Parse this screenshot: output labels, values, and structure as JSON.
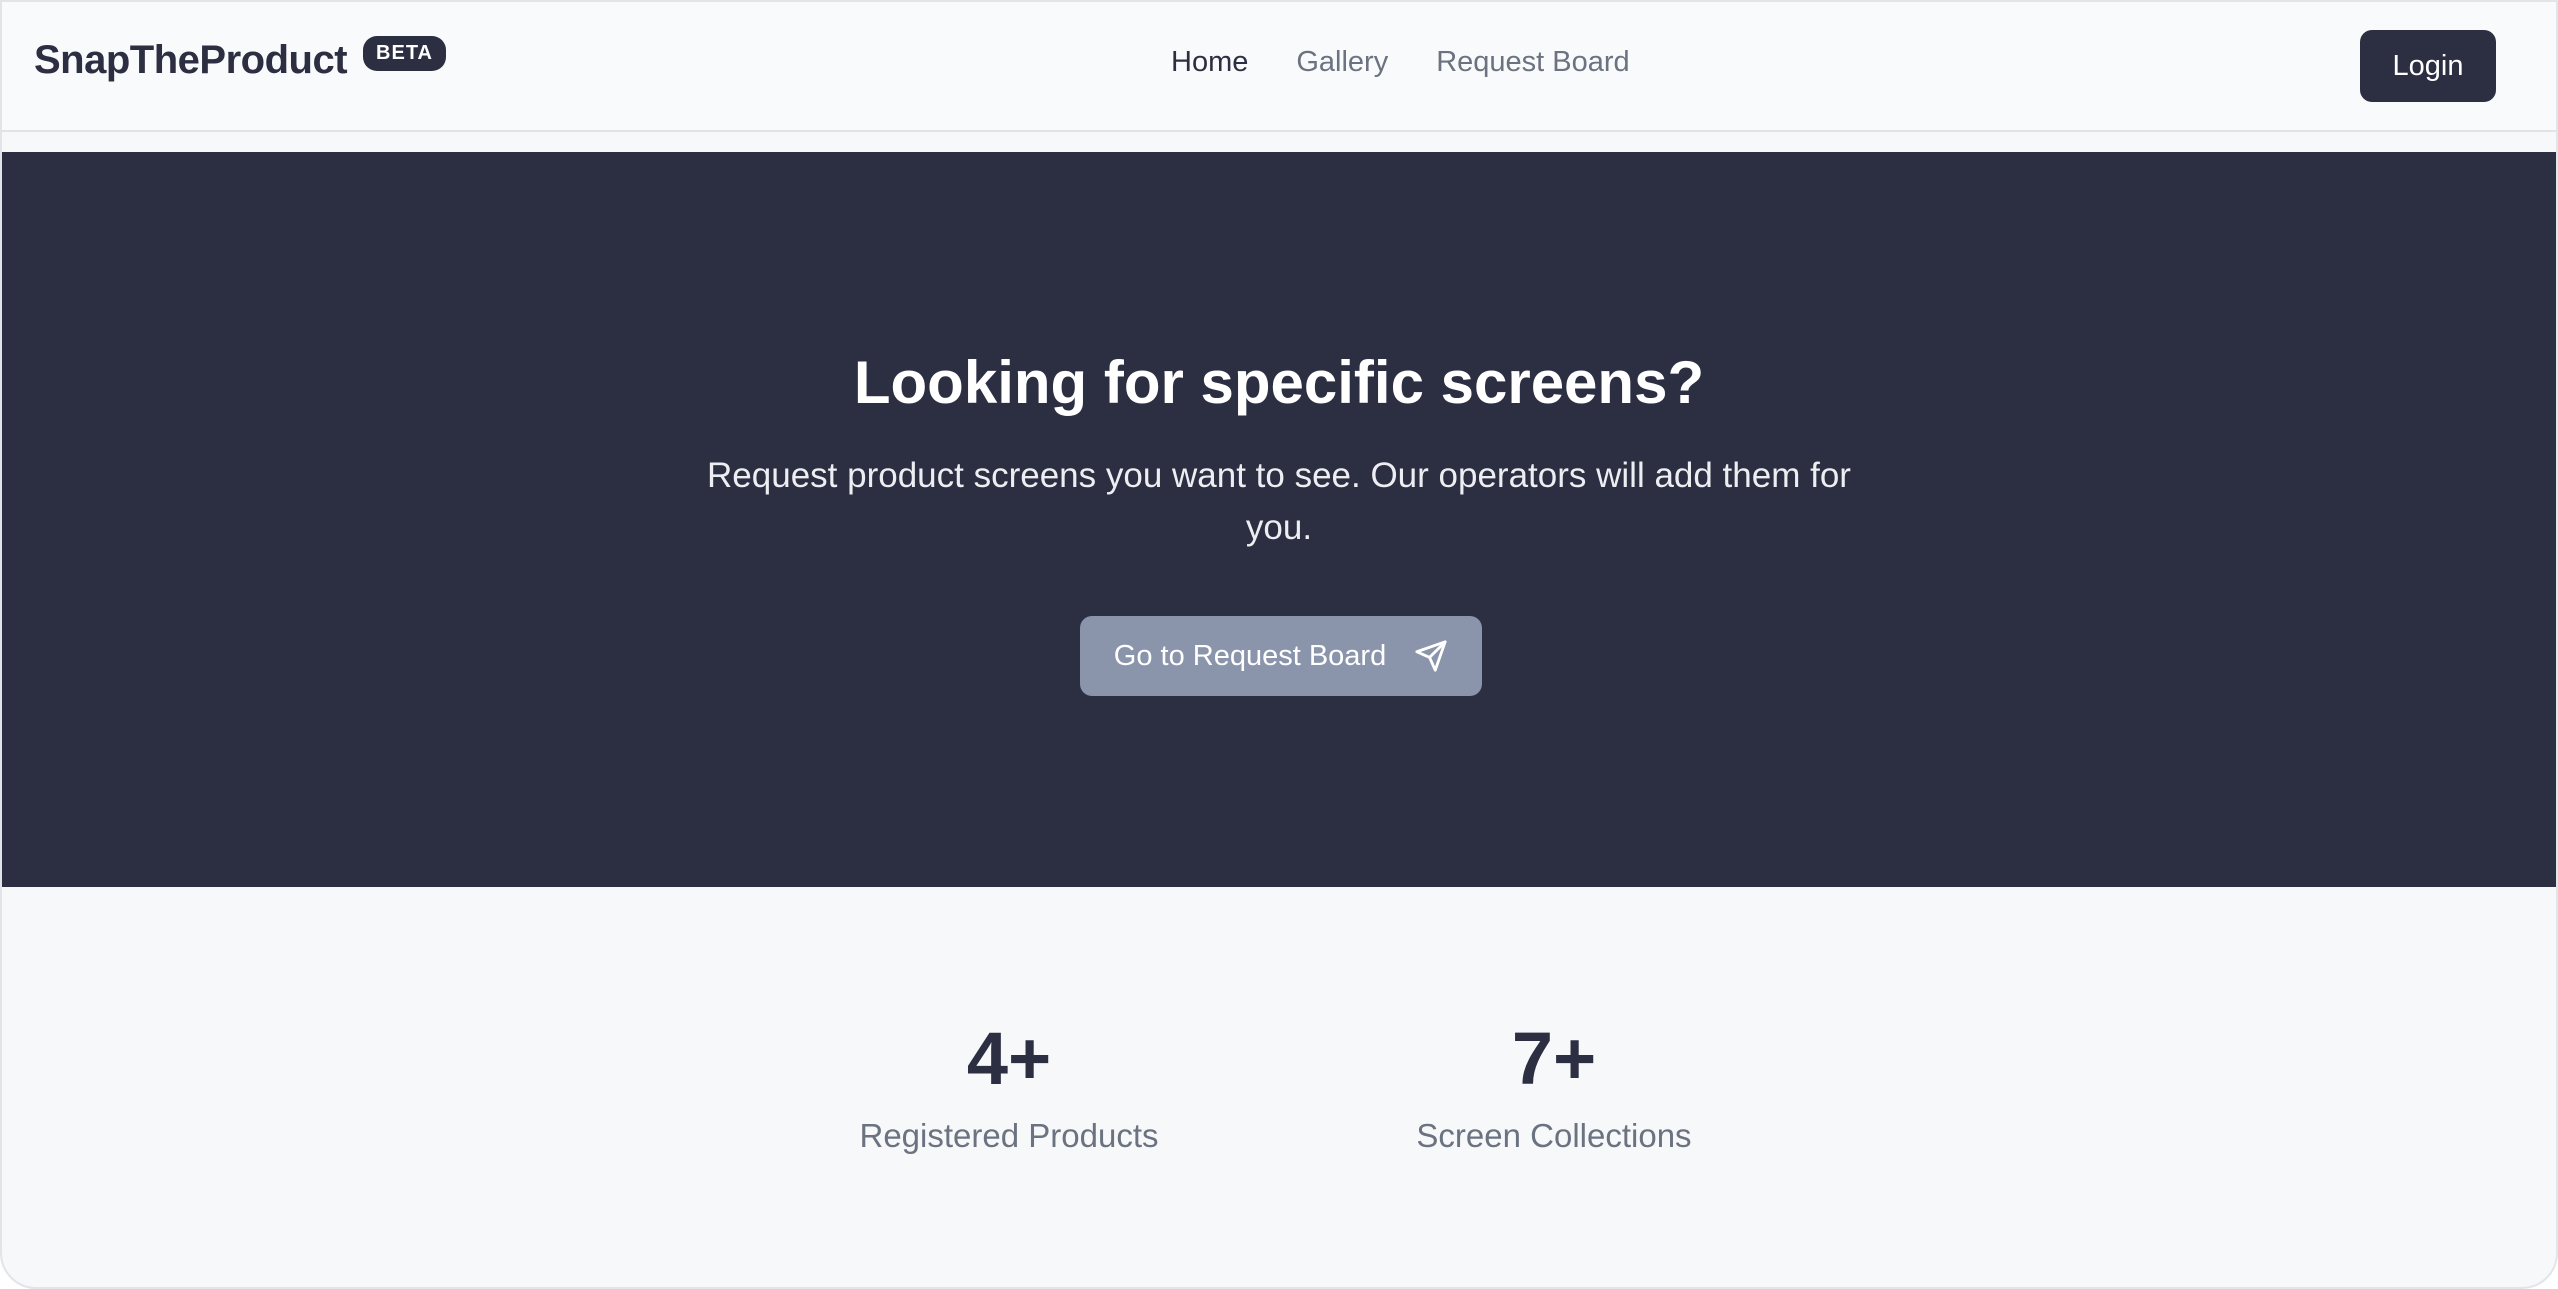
{
  "header": {
    "brand": "SnapTheProduct",
    "badge": "BETA",
    "nav": [
      {
        "label": "Home",
        "active": true
      },
      {
        "label": "Gallery",
        "active": false
      },
      {
        "label": "Request Board",
        "active": false
      }
    ],
    "login_label": "Login"
  },
  "hero": {
    "title": "Looking for specific screens?",
    "subtitle": "Request product screens you want to see. Our operators will add them for you.",
    "cta_label": "Go to Request Board",
    "cta_icon": "paper-plane-icon"
  },
  "stats": [
    {
      "value": "4+",
      "label": "Registered Products"
    },
    {
      "value": "7+",
      "label": "Screen Collections"
    }
  ],
  "colors": {
    "primary_dark": "#2c2e42",
    "cta_bg": "#8a94ab",
    "muted_text": "#6b7280",
    "page_bg": "#f7f8fa"
  }
}
